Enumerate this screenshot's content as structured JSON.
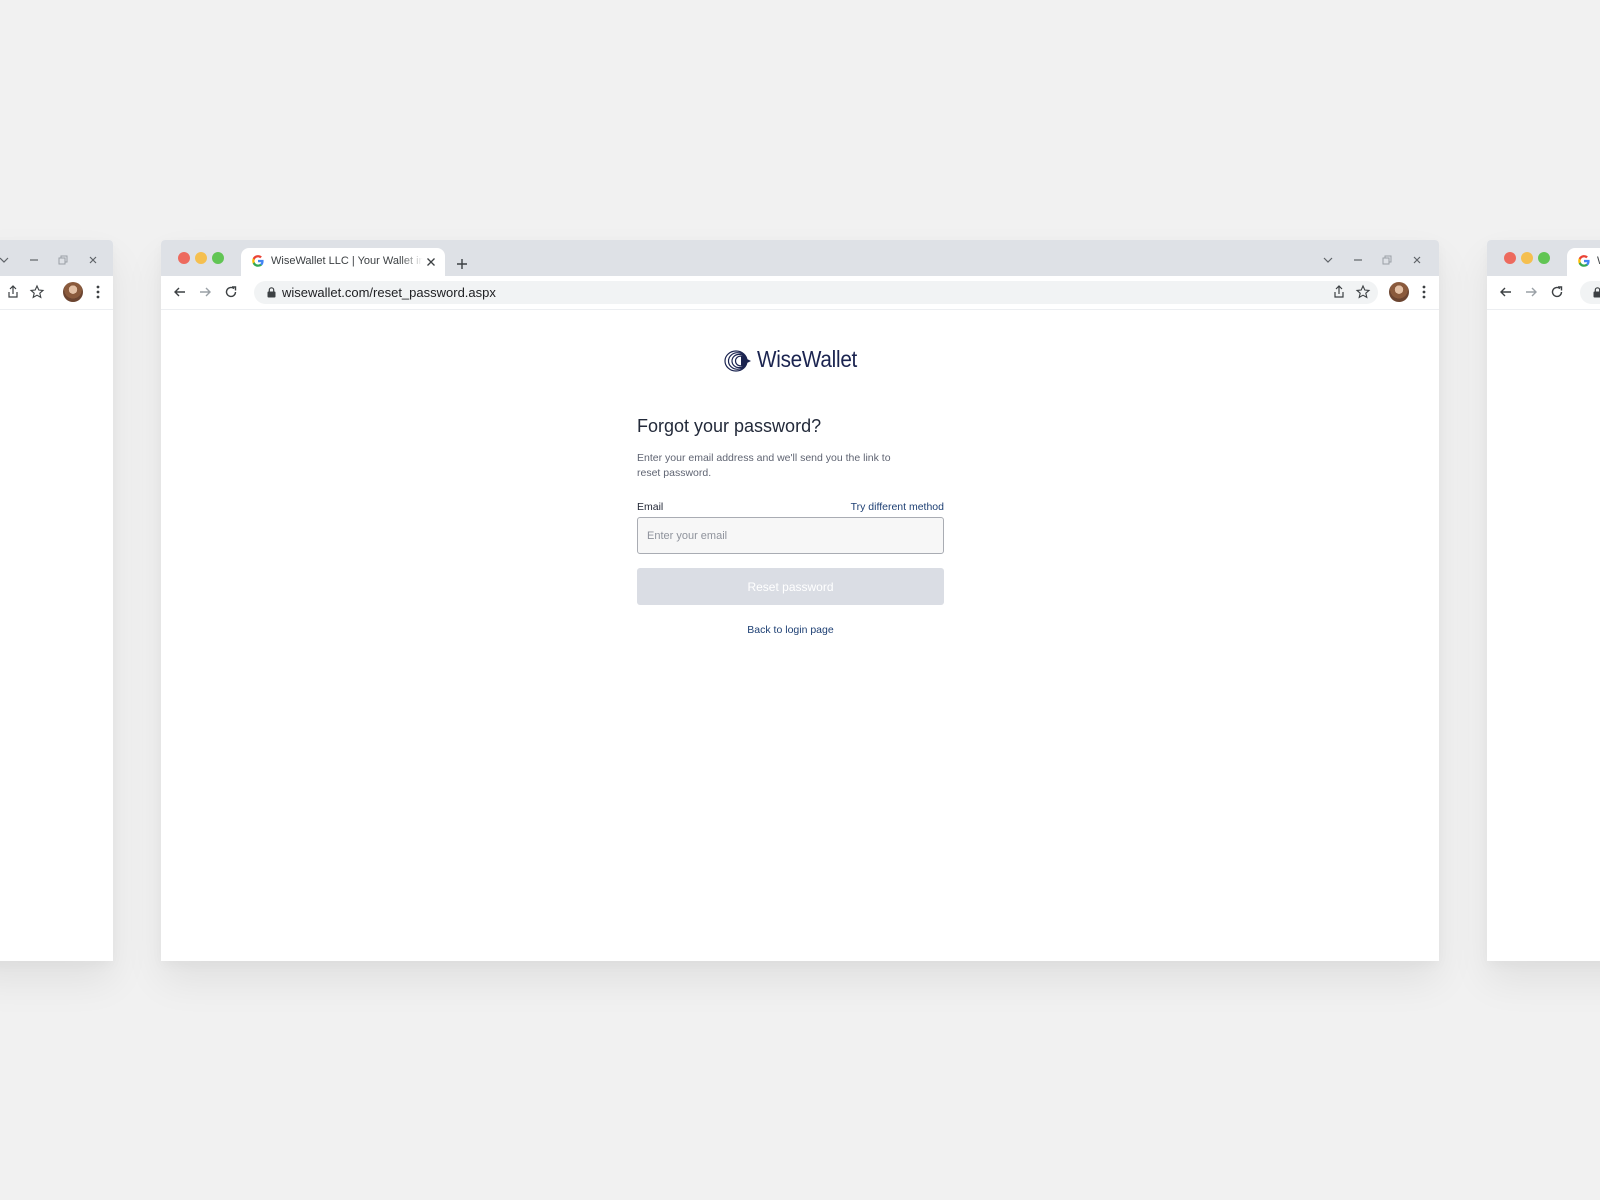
{
  "browser": {
    "tab_title": "WiseWallet LLC | Your Wallet in Safe Hands",
    "new_tab_label": "+",
    "url": "wisewallet.com/reset_password.aspx"
  },
  "page": {
    "logo_text": "WiseWallet",
    "title": "Forgot your password?",
    "description": "Enter your email address and we'll send you the link to reset password.",
    "email_label": "Email",
    "alt_method_link": "Try different method",
    "email_placeholder": "Enter your email",
    "email_value": "",
    "reset_button": "Reset password",
    "back_link": "Back to login page"
  },
  "side_window_right": {
    "tab_title": "W"
  },
  "colors": {
    "brand_navy": "#1b2450",
    "link": "#1d3f73",
    "button_disabled": "#dadde4",
    "background": "#f1f1f1"
  },
  "icons": {
    "tab_favicon": "google-icon",
    "lock": "lock-icon",
    "share": "share-icon",
    "bookmark": "star-icon",
    "profile": "avatar",
    "menu": "kebab-menu-icon"
  }
}
